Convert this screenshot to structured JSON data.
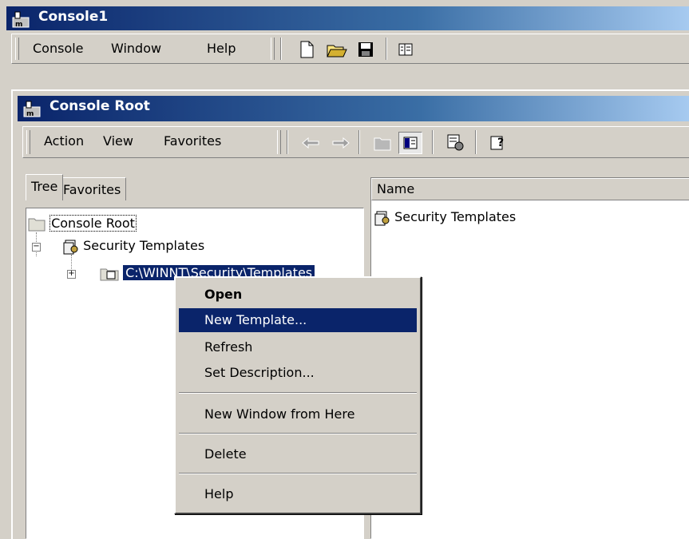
{
  "outer_window": {
    "title": "Console1",
    "menu": [
      "Console",
      "Window",
      "Help"
    ]
  },
  "inner_window": {
    "title": "Console Root",
    "menu": [
      "Action",
      "View",
      "Favorites"
    ]
  },
  "tabs": [
    "Tree",
    "Favorites"
  ],
  "tree": {
    "root": "Console Root",
    "child": "Security Templates",
    "grandchild": "C:\\WINNT\\Security\\Templates"
  },
  "list": {
    "column_header": "Name",
    "items": [
      "Security Templates"
    ]
  },
  "context_menu": {
    "open": "Open",
    "new_template": "New Template...",
    "refresh": "Refresh",
    "set_description": "Set Description...",
    "new_window": "New Window from Here",
    "delete": "Delete",
    "help": "Help"
  },
  "colors": {
    "title_active": "#0a246a",
    "face": "#d4d0c8",
    "highlight": "#0a246a"
  }
}
